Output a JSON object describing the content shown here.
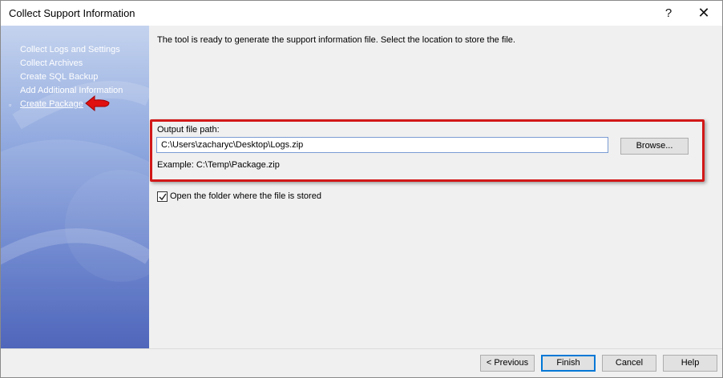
{
  "window": {
    "title": "Collect Support Information",
    "help_glyph": "?",
    "close_glyph": "✕"
  },
  "sidebar": {
    "items": [
      {
        "label": "Collect Logs and Settings"
      },
      {
        "label": "Collect Archives"
      },
      {
        "label": "Create SQL Backup"
      },
      {
        "label": "Add Additional Information"
      },
      {
        "label": "Create Package",
        "active": true
      }
    ],
    "active_bullet": "▫"
  },
  "main": {
    "intro": "The tool is ready to generate the support information file. Select the location to store the file.",
    "output_label": "Output file path:",
    "output_value": "C:\\Users\\zacharyc\\Desktop\\Logs.zip",
    "browse_label": "Browse...",
    "example": "Example: C:\\Temp\\Package.zip",
    "open_folder_label": "Open the folder where the file is stored",
    "open_folder_checked": true
  },
  "footer": {
    "previous_label": "< Previous",
    "finish_label": "Finish",
    "cancel_label": "Cancel",
    "help_label": "Help"
  },
  "colors": {
    "highlight": "#d21818",
    "annotation_arrow": "#e01010",
    "sidebar_top": "#c4d3ee",
    "sidebar_bottom": "#3c55b3"
  }
}
